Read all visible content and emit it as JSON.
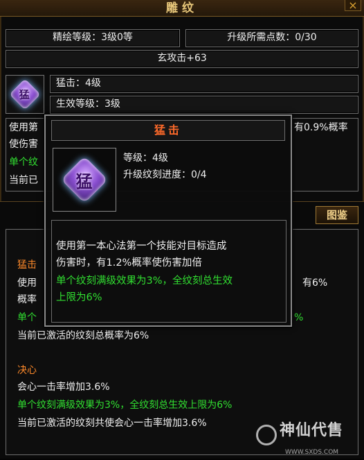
{
  "window": {
    "title": "雕纹",
    "close_label": "×"
  },
  "header": {
    "paint_level": "精绘等级：3级0等",
    "upgrade_points": "升级所需点数：0/30",
    "bonus": "玄攻击+63"
  },
  "selected": {
    "icon_glyph": "猛",
    "icon": "purple-rune-icon",
    "name": "猛击：4级",
    "effective_level": "生效等级：3级"
  },
  "bg_desc": {
    "l1a": "使用第",
    "l1b": "有0.9%概率",
    "l2": "使伤害",
    "l3": "单个纹",
    "l4": "当前已"
  },
  "illustrate_button": "图鉴",
  "list": {
    "mengji_title": "猛击",
    "mengji_l1a": "使用",
    "mengji_l1b": "有6%",
    "mengji_l2": "概率",
    "mengji_l3a": "单个",
    "mengji_l3b": "%",
    "mengji_total": "当前已激活的纹刻总概率为6%",
    "juexin_title": "决心",
    "juexin_l1": "会心一击率增加3.6%",
    "juexin_l2": "单个纹刻满级效果为3%，全纹刻总生效上限为6%",
    "juexin_l3": "当前已激活的纹刻共使会心一击率增加3.6%"
  },
  "popup": {
    "title": "猛击",
    "icon_glyph": "猛",
    "level": "等级：4级",
    "progress": "升级纹刻进度：0/4",
    "desc_l1": "使用第一本心法第一个技能对目标造成",
    "desc_l2": "伤害时，有1.2%概率使伤害加倍",
    "desc_l3": "单个纹刻满级效果为3%，全纹刻总生效",
    "desc_l4": "上限为6%"
  },
  "watermark": {
    "text": "神仙代售",
    "url": "WWW.SXDS.COM"
  },
  "colors": {
    "accent_orange": "#ff6a2a",
    "effect_green": "#31e031",
    "title_gold": "#e8c77a"
  }
}
